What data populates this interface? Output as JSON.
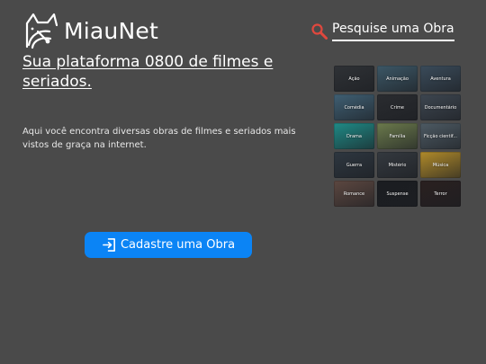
{
  "header": {
    "brand": "MiauNet",
    "logo_icon": "cat-satellite-logo-icon",
    "search_icon": "magnifier-icon",
    "search_link": "Pesquise uma Obra"
  },
  "hero": {
    "headline": "Sua plataforma 0800 de filmes e seriados.",
    "description": "Aqui você encontra diversas obras de filmes e seriados mais vistos de graça na internet.",
    "cta_label": "Cadastre uma Obra",
    "cta_icon": "sign-in-icon"
  },
  "genres": [
    {
      "label": "Ação",
      "color": "#2f3236"
    },
    {
      "label": "Animação",
      "color": "#3c5766"
    },
    {
      "label": "Aventura",
      "color": "#3a4b5a"
    },
    {
      "label": "Comédia",
      "color": "#3f5f73"
    },
    {
      "label": "Crime",
      "color": "#2a2c30"
    },
    {
      "label": "Documentário",
      "color": "#3d4650"
    },
    {
      "label": "Drama",
      "color": "#1f8a86"
    },
    {
      "label": "Família",
      "color": "#6b7a4c"
    },
    {
      "label": "Ficção científ...",
      "color": "#4d5a63"
    },
    {
      "label": "Guerra",
      "color": "#2e3740"
    },
    {
      "label": "Mistério",
      "color": "#34393f"
    },
    {
      "label": "Música",
      "color": "#b08a2a"
    },
    {
      "label": "Romance",
      "color": "#5c4740"
    },
    {
      "label": "Suspense",
      "color": "#1b1d21"
    },
    {
      "label": "Terror",
      "color": "#2a2020"
    }
  ],
  "colors": {
    "background": "#4a4a4a",
    "accent": "#0b84f5",
    "search_icon": "#e0483e"
  }
}
